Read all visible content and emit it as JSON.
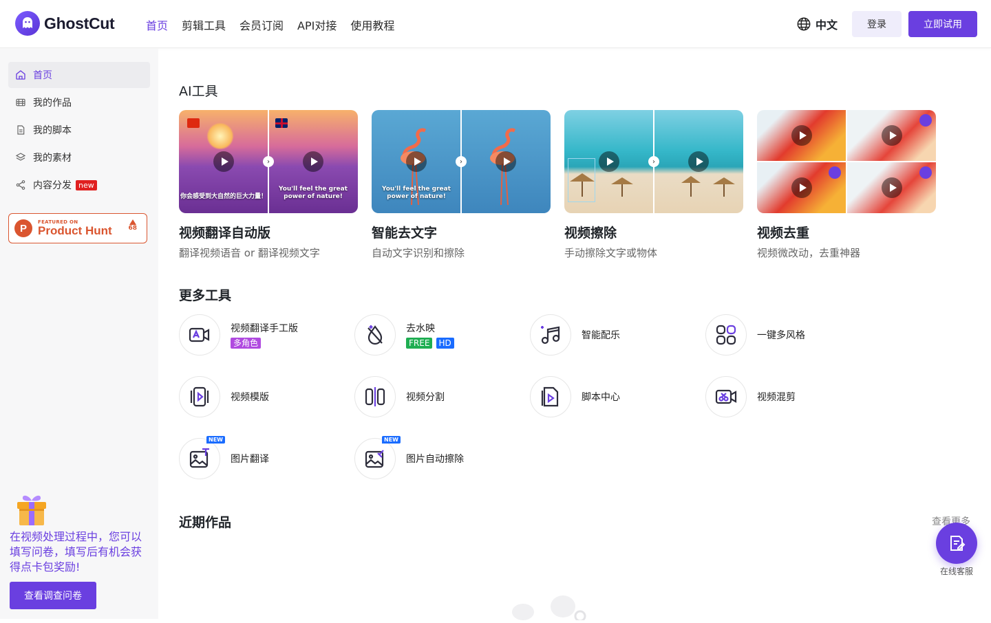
{
  "header": {
    "brand": "GhostCut",
    "nav": [
      {
        "label": "首页",
        "active": true
      },
      {
        "label": "剪辑工具",
        "active": false
      },
      {
        "label": "会员订阅",
        "active": false
      },
      {
        "label": "API对接",
        "active": false
      },
      {
        "label": "使用教程",
        "active": false
      }
    ],
    "language": "中文",
    "login_label": "登录",
    "try_label": "立即试用"
  },
  "sidebar": {
    "items": [
      {
        "label": "首页",
        "icon": "home-icon",
        "active": true
      },
      {
        "label": "我的作品",
        "icon": "film-icon",
        "active": false
      },
      {
        "label": "我的脚本",
        "icon": "document-icon",
        "active": false
      },
      {
        "label": "我的素材",
        "icon": "layers-icon",
        "active": false
      },
      {
        "label": "内容分发",
        "icon": "share-icon",
        "active": false,
        "badge": "new"
      }
    ],
    "product_hunt": {
      "small": "FEATURED ON",
      "big": "Product Hunt",
      "votes": "68"
    },
    "survey_text": "在视频处理过程中，您可以填写问卷，填写后有机会获得点卡包奖励!",
    "survey_button": "查看调查问卷"
  },
  "main": {
    "ai_tools_title": "AI工具",
    "ai_tools": [
      {
        "title": "视频翻译自动版",
        "subtitle": "翻译视频语音 or 翻译视频文字",
        "caption_left": "你会感受到大自然的巨大力量！",
        "caption_right": "You'll feel the great power of nature!"
      },
      {
        "title": "智能去文字",
        "subtitle": "自动文字识别和擦除",
        "caption_left": "You'll feel the great power of nature!"
      },
      {
        "title": "视频擦除",
        "subtitle": "手动擦除文字或物体"
      },
      {
        "title": "视频去重",
        "subtitle": "视频微改动，去重神器"
      }
    ],
    "more_tools_title": "更多工具",
    "more_tools": [
      {
        "name": "视频翻译手工版",
        "icon": "video-translate-icon",
        "tags": [
          "多角色"
        ]
      },
      {
        "name": "去水映",
        "icon": "watermark-remove-icon",
        "tags": [
          "FREE",
          "HD"
        ]
      },
      {
        "name": "智能配乐",
        "icon": "music-note-icon",
        "tags": []
      },
      {
        "name": "一键多风格",
        "icon": "grid-icon",
        "tags": []
      },
      {
        "name": "视频模版",
        "icon": "video-template-icon",
        "tags": []
      },
      {
        "name": "视频分割",
        "icon": "split-icon",
        "tags": []
      },
      {
        "name": "脚本中心",
        "icon": "script-icon",
        "tags": []
      },
      {
        "name": "视频混剪",
        "icon": "video-mix-icon",
        "tags": []
      },
      {
        "name": "图片翻译",
        "icon": "image-translate-icon",
        "tags": [],
        "new": "NEW"
      },
      {
        "name": "图片自动擦除",
        "icon": "image-erase-icon",
        "tags": [],
        "new": "NEW"
      }
    ],
    "recent_title": "近期作品",
    "see_more": "查看更多",
    "customer_service": "在线客服"
  },
  "colors": {
    "accent": "#6a3fe0",
    "ph": "#da552f",
    "new_blue": "#1a6cff"
  }
}
